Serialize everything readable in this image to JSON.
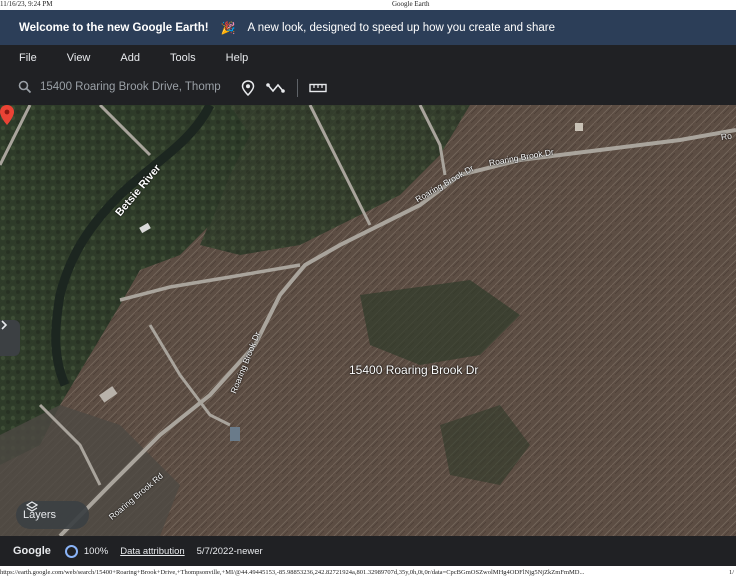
{
  "print": {
    "timestamp": "11/16/23, 9:24 PM",
    "title": "Google Earth",
    "url": "https://earth.google.com/web/search/15400+Roaring+Brook+Drive,+Thompsonville,+MI/@44.49445153,-85.98853236,242.82721924a,801.32989707d,35y,0h,0t,0r/data=CpcBGmOSZwolMHg4ODFlNjg5NjZkZmFmMD...",
    "page": "1/"
  },
  "banner": {
    "title": "Welcome to the new Google Earth!",
    "emoji": "🎉",
    "message": "A new look, designed to speed up how you create and share"
  },
  "menu": [
    "File",
    "View",
    "Add",
    "Tools",
    "Help"
  ],
  "search": {
    "value": "15400 Roaring Brook Drive, Thomp",
    "icons": [
      "search-icon",
      "pin-icon",
      "route-icon",
      "ruler-icon"
    ]
  },
  "map": {
    "river_label": "Betsie River",
    "road_labels": {
      "a": "Roaring Brook Dr",
      "b": "Roaring Brook Dr",
      "c": "Roaring Brook Dr",
      "d": "Roaring Brook Rd",
      "e": "Ro"
    },
    "place_label": "15400 Roaring Brook Dr",
    "pin_color": "#ea4335"
  },
  "layers": {
    "label": "Layers",
    "icon": "layers-icon"
  },
  "status": {
    "logo": "Google",
    "zoom": "100%",
    "attribution": "Data attribution",
    "imagery_date": "5/7/2022-newer"
  }
}
